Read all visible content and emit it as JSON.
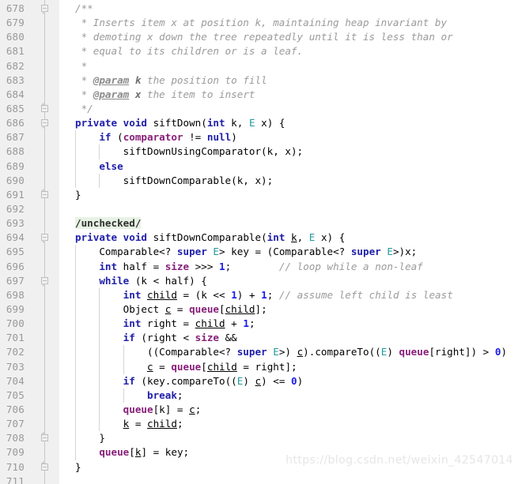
{
  "editor": {
    "language": "java",
    "first_line": 678,
    "last_line": 711,
    "gutter_bg": "#f0f0f0",
    "code_bg": "#ffffff"
  },
  "watermark": {
    "text": "https://blog.csdn.net/weixin_42547014"
  },
  "colors": {
    "keyword": "#2020aa",
    "field": "#871f78",
    "type_param": "#20999d",
    "number": "#1a1aee",
    "comment": "#9b9b9b",
    "annotation_bg": "#e7f2e4",
    "line_number": "#999999"
  },
  "line_numbers": [
    "678",
    "679",
    "680",
    "681",
    "682",
    "683",
    "684",
    "685",
    "686",
    "687",
    "688",
    "689",
    "690",
    "691",
    "692",
    "693",
    "694",
    "695",
    "696",
    "697",
    "698",
    "699",
    "700",
    "701",
    "702",
    "703",
    "704",
    "705",
    "706",
    "707",
    "708",
    "709",
    "710",
    "711"
  ],
  "fold_markers": [
    {
      "line": "678",
      "kind": "start"
    },
    {
      "line": "685",
      "kind": "end"
    },
    {
      "line": "686",
      "kind": "start"
    },
    {
      "line": "691",
      "kind": "end"
    },
    {
      "line": "694",
      "kind": "start"
    },
    {
      "line": "697",
      "kind": "start"
    },
    {
      "line": "708",
      "kind": "end"
    },
    {
      "line": "710",
      "kind": "end"
    }
  ],
  "lines": [
    {
      "n": "678",
      "text": "    /**"
    },
    {
      "n": "679",
      "text": "     * Inserts item x at position k, maintaining heap invariant by"
    },
    {
      "n": "680",
      "text": "     * demoting x down the tree repeatedly until it is less than or"
    },
    {
      "n": "681",
      "text": "     * equal to its children or is a leaf."
    },
    {
      "n": "682",
      "text": "     *"
    },
    {
      "n": "683",
      "text": "     * @param k the position to fill"
    },
    {
      "n": "684",
      "text": "     * @param x the item to insert"
    },
    {
      "n": "685",
      "text": "     */"
    },
    {
      "n": "686",
      "text": "    private void siftDown(int k, E x) {"
    },
    {
      "n": "687",
      "text": "        if (comparator != null)"
    },
    {
      "n": "688",
      "text": "            siftDownUsingComparator(k, x);"
    },
    {
      "n": "689",
      "text": "        else"
    },
    {
      "n": "690",
      "text": "            siftDownComparable(k, x);"
    },
    {
      "n": "691",
      "text": "    }"
    },
    {
      "n": "692",
      "text": ""
    },
    {
      "n": "693",
      "text": "    /unchecked/"
    },
    {
      "n": "694",
      "text": "    private void siftDownComparable(int k, E x) {"
    },
    {
      "n": "695",
      "text": "        Comparable<? super E> key = (Comparable<? super E>)x;"
    },
    {
      "n": "696",
      "text": "        int half = size >>> 1;          // loop while a non-leaf"
    },
    {
      "n": "697",
      "text": "        while (k < half) {"
    },
    {
      "n": "698",
      "text": "            int child = (k << 1) + 1; // assume left child is least"
    },
    {
      "n": "699",
      "text": "            Object c = queue[child];"
    },
    {
      "n": "700",
      "text": "            int right = child + 1;"
    },
    {
      "n": "701",
      "text": "            if (right < size &&"
    },
    {
      "n": "702",
      "text": "                ((Comparable<? super E>) c).compareTo((E) queue[right]) > 0)"
    },
    {
      "n": "703",
      "text": "                c = queue[child = right];"
    },
    {
      "n": "704",
      "text": "            if (key.compareTo((E) c) <= 0)"
    },
    {
      "n": "705",
      "text": "                break;"
    },
    {
      "n": "706",
      "text": "            queue[k] = c;"
    },
    {
      "n": "707",
      "text": "            k = child;"
    },
    {
      "n": "708",
      "text": "        }"
    },
    {
      "n": "709",
      "text": "        queue[k] = key;"
    },
    {
      "n": "710",
      "text": "    }"
    },
    {
      "n": "711",
      "text": ""
    }
  ],
  "code_html": [
    "<span class=\"cmt\">/**</span>",
    "<span class=\"cmt\"> * Inserts item x at position k, maintaining heap invariant by</span>",
    "<span class=\"cmt\"> * demoting x down the tree repeatedly until it is less than or</span>",
    "<span class=\"cmt\"> * equal to its children or is a leaf.</span>",
    "<span class=\"cmt\"> *</span>",
    "<span class=\"cmt\"> * </span><span class=\"tag\">@param</span><span class=\"cmt\"> </span><span class=\"tagp\">k</span><span class=\"cmt\"> the position to fill</span>",
    "<span class=\"cmt\"> * </span><span class=\"tag\">@param</span><span class=\"cmt\"> </span><span class=\"tagp\">x</span><span class=\"cmt\"> the item to insert</span>",
    "<span class=\"cmt\"> */</span>",
    "<span class=\"kw\">private</span> <span class=\"kw\">void</span> siftDown(<span class=\"kw\">int</span> k, <span class=\"typ\">E</span> x) {",
    "    <span class=\"kw\">if</span> (<span class=\"fld\">comparator</span> != <span class=\"kw\">null</span>)",
    "        siftDownUsingComparator(k, x);",
    "    <span class=\"kw\">else</span>",
    "        siftDownComparable(k, x);",
    "}",
    "",
    "<span class=\"ann\">/unchecked/</span>",
    "<span class=\"kw\">private</span> <span class=\"kw\">void</span> siftDownComparable(<span class=\"kw\">int</span> <span class=\"loc\">k</span>, <span class=\"typ\">E</span> x) {",
    "    Comparable&lt;? <span class=\"kw\">super</span> <span class=\"typ\">E</span>&gt; key = (Comparable&lt;? <span class=\"kw\">super</span> <span class=\"typ\">E</span>&gt;)x;",
    "    <span class=\"kw\">int</span> half = <span class=\"fld\">size</span> &gt;&gt;&gt; <span class=\"num\">1</span>;        <span class=\"cmt\">// loop while a non-leaf</span>",
    "    <span class=\"kw\">while</span> (k &lt; half) {",
    "        <span class=\"kw\">int</span> <span class=\"loc\">child</span> = (k &lt;&lt; <span class=\"num\">1</span>) + <span class=\"num\">1</span>; <span class=\"cmt\">// assume left child is least</span>",
    "        Object <span class=\"loc\">c</span> = <span class=\"fld\">queue</span>[<span class=\"loc\">child</span>];",
    "        <span class=\"kw\">int</span> right = <span class=\"loc\">child</span> + <span class=\"num\">1</span>;",
    "        <span class=\"kw\">if</span> (right &lt; <span class=\"fld\">size</span> &amp;&amp;",
    "            ((Comparable&lt;? <span class=\"kw\">super</span> <span class=\"typ\">E</span>&gt;) <span class=\"loc\">c</span>).compareTo((<span class=\"typ\">E</span>) <span class=\"fld\">queue</span>[right]) &gt; <span class=\"num\">0</span>)",
    "            <span class=\"loc\">c</span> = <span class=\"fld\">queue</span>[<span class=\"loc\">child</span> = right];",
    "        <span class=\"kw\">if</span> (key.compareTo((<span class=\"typ\">E</span>) <span class=\"loc\">c</span>) &lt;= <span class=\"num\">0</span>)",
    "            <span class=\"kw\">break</span>;",
    "        <span class=\"fld\">queue</span>[k] = <span class=\"loc\">c</span>;",
    "        <span class=\"loc\">k</span> = <span class=\"loc\">child</span>;",
    "    }",
    "    <span class=\"fld\">queue</span>[<span class=\"loc\">k</span>] = key;",
    "}",
    ""
  ],
  "indent_guides": [
    [],
    [],
    [],
    [],
    [],
    [],
    [],
    [],
    [],
    [
      0
    ],
    [
      0,
      1
    ],
    [
      0
    ],
    [
      0,
      1
    ],
    [],
    [],
    [],
    [],
    [
      0
    ],
    [
      0
    ],
    [
      0
    ],
    [
      0,
      1
    ],
    [
      0,
      1
    ],
    [
      0,
      1
    ],
    [
      0,
      1
    ],
    [
      0,
      1,
      2
    ],
    [
      0,
      1,
      2
    ],
    [
      0,
      1
    ],
    [
      0,
      1,
      2
    ],
    [
      0,
      1
    ],
    [
      0,
      1
    ],
    [
      0
    ],
    [
      0
    ],
    [],
    []
  ]
}
